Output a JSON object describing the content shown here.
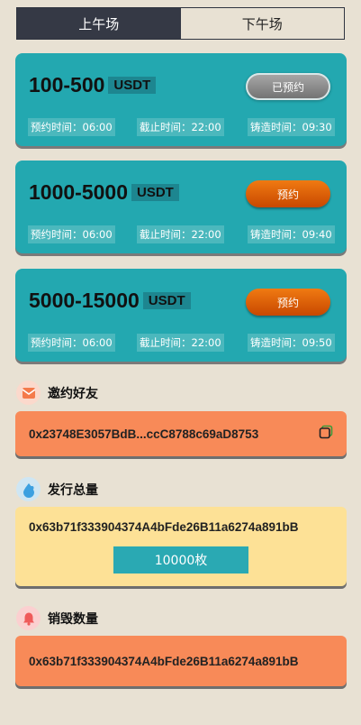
{
  "tabs": {
    "morning": "上午场",
    "afternoon": "下午场"
  },
  "cards": [
    {
      "range": "100-500",
      "currency": "USDT",
      "button": "已预约",
      "reserve_time": "预约时间：06:00",
      "deadline": "截止时间：22:00",
      "mint_time": "铸造时间：09:30"
    },
    {
      "range": "1000-5000",
      "currency": "USDT",
      "button": "预约",
      "reserve_time": "预约时间：06:00",
      "deadline": "截止时间：22:00",
      "mint_time": "铸造时间：09:40"
    },
    {
      "range": "5000-15000",
      "currency": "USDT",
      "button": "预约",
      "reserve_time": "预约时间：06:00",
      "deadline": "截止时间：22:00",
      "mint_time": "铸造时间：09:50"
    }
  ],
  "invite": {
    "title": "邀约好友",
    "address": "0x23748E3057BdB...ccC8788c69aD8753"
  },
  "issuance": {
    "title": "发行总量",
    "address": "0x63b71f333904374A4bFde26B11a6274a891bB",
    "count": "10000枚"
  },
  "burn": {
    "title": "销毁数量",
    "address": "0x63b71f333904374A4bFde26B11a6274a891bB"
  },
  "colors": {
    "teal": "#23a8b0",
    "orange": "#f88a58",
    "yellow": "#fde196",
    "dark": "#353945"
  }
}
